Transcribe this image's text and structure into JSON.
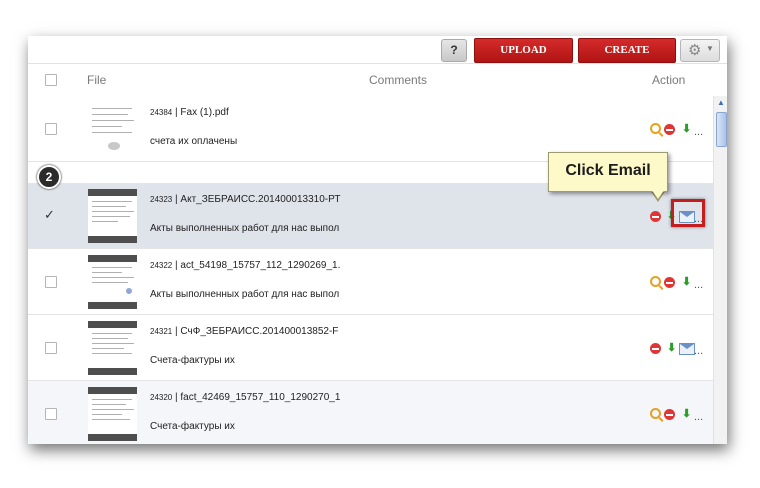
{
  "toolbar": {
    "help_label": "?",
    "upload_label": "UPLOAD",
    "create_label": "CREATE",
    "gear_icon": "gear-icon"
  },
  "columns": {
    "file": "File",
    "comments": "Comments",
    "action": "Action"
  },
  "rows": [
    {
      "id": "24384",
      "name": "Fax (1).pdf",
      "comment": "счета их оплачены",
      "selected": false,
      "actions": [
        "magnify-icon",
        "delete-icon",
        "download-icon",
        "more-icon"
      ]
    },
    {
      "id": "24323",
      "name": "Акт_ЗЕБРАИСС.201400013310-РТ",
      "comment": "Акты выполненных работ для нас выпол",
      "selected": true,
      "actions": [
        "delete-icon",
        "download-icon",
        "email-icon",
        "more-icon"
      ]
    },
    {
      "id": "24322",
      "name": "act_54198_15757_112_1290269_1.",
      "comment": "Акты выполненных работ для нас выпол",
      "selected": false,
      "actions": [
        "magnify-icon",
        "delete-icon",
        "download-icon",
        "more-icon"
      ]
    },
    {
      "id": "24321",
      "name": "СчФ_ЗЕБРАИСС.201400013852-F",
      "comment": "Счета-фактуры их",
      "selected": false,
      "actions": [
        "delete-icon",
        "download-icon",
        "email-icon",
        "more-icon"
      ]
    },
    {
      "id": "24320",
      "name": "fact_42469_15757_110_1290270_1",
      "comment": "Счета-фактуры их",
      "selected": false,
      "actions": [
        "magnify-icon",
        "delete-icon",
        "download-icon",
        "more-icon"
      ]
    }
  ],
  "separator": " | ",
  "more_text": "...",
  "annotation": {
    "step_number": "2",
    "callout_text": "Click Email",
    "highlight_color": "#c21e1e"
  },
  "colors": {
    "primary_button": "#c21e1e",
    "selected_row": "#dfe3ea",
    "callout_bg": "#fdf9c9"
  }
}
